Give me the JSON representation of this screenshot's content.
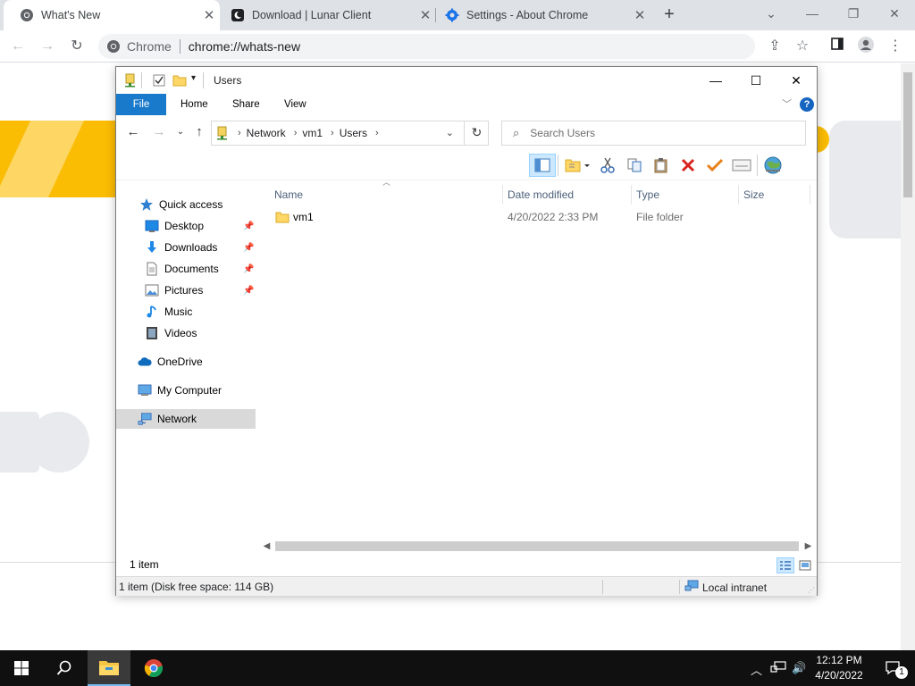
{
  "chrome": {
    "tabs": [
      {
        "title": "What's New",
        "icon": "chrome-logo-icon",
        "active": true
      },
      {
        "title": "Download | Lunar Client",
        "icon": "lunar-client-icon",
        "active": false
      },
      {
        "title": "Settings - About Chrome",
        "icon": "settings-gear-icon",
        "active": false
      }
    ],
    "omnibox": {
      "brand": "Chrome",
      "url": "chrome://whats-new"
    }
  },
  "explorer": {
    "title": "Users",
    "ribbon_tabs": [
      "File",
      "Home",
      "Share",
      "View"
    ],
    "address": {
      "segments": [
        "Network",
        "vm1",
        "Users"
      ]
    },
    "search_placeholder": "Search Users",
    "nav": {
      "quick_access": "Quick access",
      "items": [
        {
          "label": "Desktop",
          "icon": "desktop-icon",
          "pinned": true
        },
        {
          "label": "Downloads",
          "icon": "downloads-icon",
          "pinned": true
        },
        {
          "label": "Documents",
          "icon": "documents-icon",
          "pinned": true
        },
        {
          "label": "Pictures",
          "icon": "pictures-icon",
          "pinned": true
        },
        {
          "label": "Music",
          "icon": "music-icon",
          "pinned": false
        },
        {
          "label": "Videos",
          "icon": "videos-icon",
          "pinned": false
        }
      ],
      "onedrive": "OneDrive",
      "my_computer": "My Computer",
      "network": "Network"
    },
    "columns": [
      "Name",
      "Date modified",
      "Type",
      "Size"
    ],
    "rows": [
      {
        "name": "vm1",
        "date": "4/20/2022 2:33 PM",
        "type": "File folder",
        "size": ""
      }
    ],
    "item_count": "1 item",
    "status": {
      "left": "1 item (Disk free space: 114 GB)",
      "zone": "Local intranet"
    }
  },
  "taskbar": {
    "clock_time": "12:12 PM",
    "clock_date": "4/20/2022",
    "notification_count": "1"
  },
  "colors": {
    "accent": "#1979ca",
    "chrome_bar": "#dee1e6",
    "taskbar": "#101010",
    "folder": "#ffd766"
  }
}
